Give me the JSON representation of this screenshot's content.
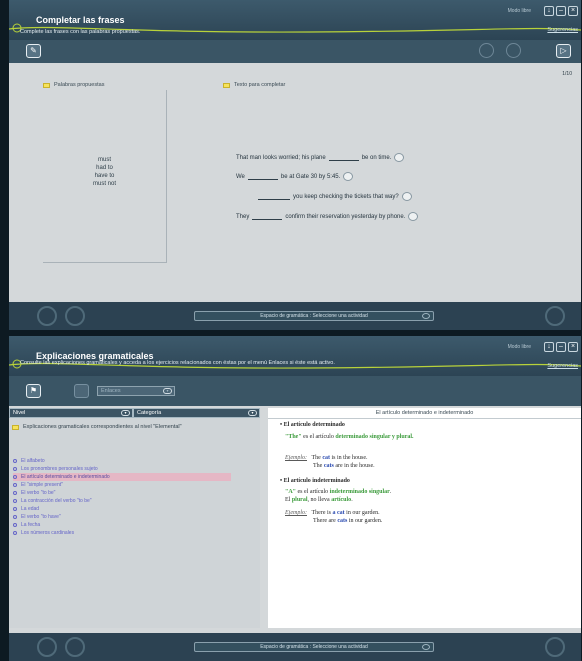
{
  "panel1": {
    "title": "Completar las frases",
    "subtitle": "Complete las frases con las palabras propuestas.",
    "mode": "Modo libre",
    "help": "Sugerencias",
    "counter": "1/10",
    "words_header": "Palabras propuestas",
    "text_header": "Texto para completar",
    "words": [
      "must",
      "had to",
      "have to",
      "must not"
    ],
    "sentences": [
      {
        "before": "That man looks worried; his plane",
        "after": "be on time."
      },
      {
        "before": "We",
        "after": "be at Gate 30 by 5:45."
      },
      {
        "before": "",
        "after": "you keep checking the tickets that way?"
      },
      {
        "before": "They",
        "after": "confirm their reservation yesterday by phone."
      }
    ],
    "footer": "Espacio de gramática : Seleccione una actividad"
  },
  "panel2": {
    "title": "Explicaciones gramaticales",
    "subtitle": "Consulte las explicaciones gramaticales y acceda a los ejercicios relacionados con éstas por el menú Enlaces si éste está activo.",
    "mode": "Modo libre",
    "help": "Sugerencias",
    "links": "Enlaces",
    "nivel": "Nivel",
    "categoria": "Categoría",
    "topic": "Explicaciones gramaticales correspondientes al nivel \"Elemental\"",
    "items": [
      "El alfabeto",
      "Los pronombres personales sujeto",
      "El artículo determinado e indeterminado",
      "El \"simple present\"",
      "El verbo \"to be\"",
      "La contracción del verbo \"to be\"",
      "La edad",
      "El verbo \"to have\"",
      "La fecha",
      "Los números cardinales"
    ],
    "right_title": "El artículo determinado e indeterminado",
    "explanation": {
      "s1_heading": "• El artículo determinado",
      "s1_the": "\"The\"",
      "s1_text": " es el artículo ",
      "s1_term": "determinado singular",
      "s1_text2": " y plural.",
      "ejemplo": "Ejemplo:",
      "s1_ex1": [
        "The ",
        "cat",
        " is in the house."
      ],
      "s1_ex2": [
        "The ",
        "cats",
        " are in the house."
      ],
      "s2_heading": "• El artículo indeterminado",
      "s2_a": "\"A\"",
      "s2_text": " es el artículo ",
      "s2_term": "indeterminado singular",
      "s2_line2a": "El ",
      "s2_plural": "plural",
      "s2_line2b": ", no lleva ",
      "s2_articulo": "artículo",
      "s2_ex1": [
        "There is ",
        "a cat",
        " in our garden."
      ],
      "s2_ex2": [
        "There are ",
        "cats",
        " in our garden."
      ]
    },
    "footer": "Espacio de gramática : Seleccione una actividad"
  }
}
